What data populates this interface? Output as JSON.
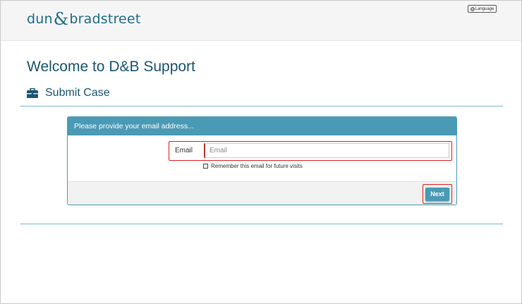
{
  "header": {
    "logo_left": "dun",
    "logo_amp": "&",
    "logo_right": "bradstreet",
    "language_label": "Language"
  },
  "main": {
    "page_title": "Welcome to D&B Support",
    "section_title": "Submit Case"
  },
  "panel": {
    "heading": "Please provide your email address...",
    "email_label": "Email",
    "email_value": "",
    "email_placeholder": "Email",
    "remember_label": "Remember this email for future visits",
    "remember_checked": false,
    "next_label": "Next"
  },
  "colors": {
    "brand": "#1f6d8a",
    "panel_header": "#4a9ab5",
    "highlight": "#e02020"
  }
}
